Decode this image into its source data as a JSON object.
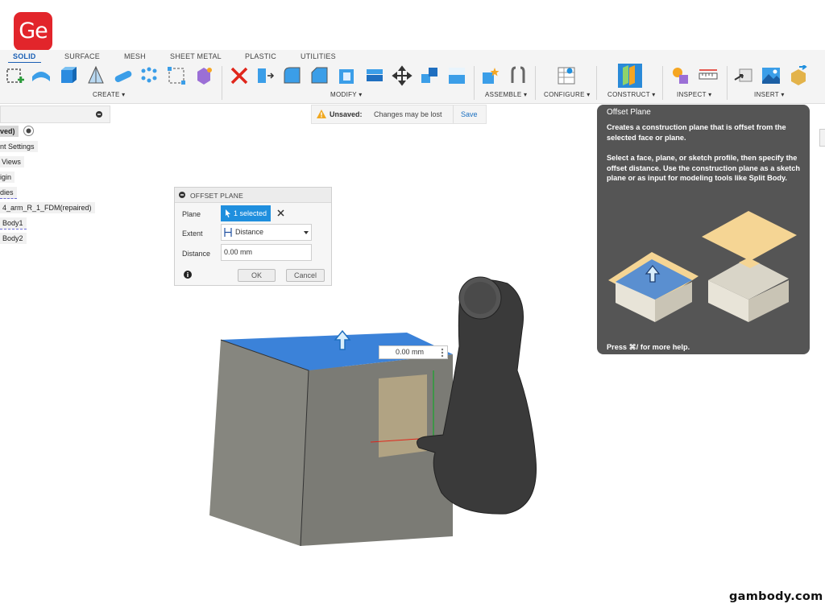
{
  "logo": {
    "text": "Ge"
  },
  "tabs": [
    "SOLID",
    "SURFACE",
    "MESH",
    "SHEET METAL",
    "PLASTIC",
    "UTILITIES"
  ],
  "groups": {
    "create": "CREATE ▾",
    "modify": "MODIFY ▾",
    "assemble": "ASSEMBLE ▾",
    "configure": "CONFIGURE ▾",
    "construct": "CONSTRUCT ▾",
    "inspect": "INSPECT ▾",
    "insert": "INSERT ▾"
  },
  "status": {
    "label": "Unsaved:",
    "message": "Changes may be lost",
    "save": "Save"
  },
  "browser": {
    "items": [
      "ved)",
      "nt Settings",
      "Views",
      "igin",
      "dies",
      "4_arm_R_1_FDM(repaired)",
      "Body1",
      "Body2"
    ]
  },
  "dialog": {
    "title": "OFFSET PLANE",
    "plane_label": "Plane",
    "plane_value": "1 selected",
    "extent_label": "Extent",
    "extent_value": "Distance",
    "distance_label": "Distance",
    "distance_value": "0.00 mm",
    "ok": "OK",
    "cancel": "Cancel"
  },
  "viewport": {
    "inline_distance": "0.00 mm"
  },
  "tooltip": {
    "title": "Offset Plane",
    "para1": "Creates a construction plane that is offset from the selected face or plane.",
    "para2": "Select a face, plane, or sketch profile, then specify the offset distance. Use the construction plane as a sketch plane or as input for modeling tools like Split Body.",
    "footer": "Press ⌘/ for more help."
  },
  "watermark": "gambody.com",
  "colors": {
    "accent": "#1f8fde",
    "tab_active": "#1a5fb4",
    "tooltip_bg": "#555555",
    "face_blue": "#3b82d9",
    "cube_grey": "#8c8c88",
    "plane_yellow": "#f5d594",
    "logo_red": "#e2252b"
  }
}
